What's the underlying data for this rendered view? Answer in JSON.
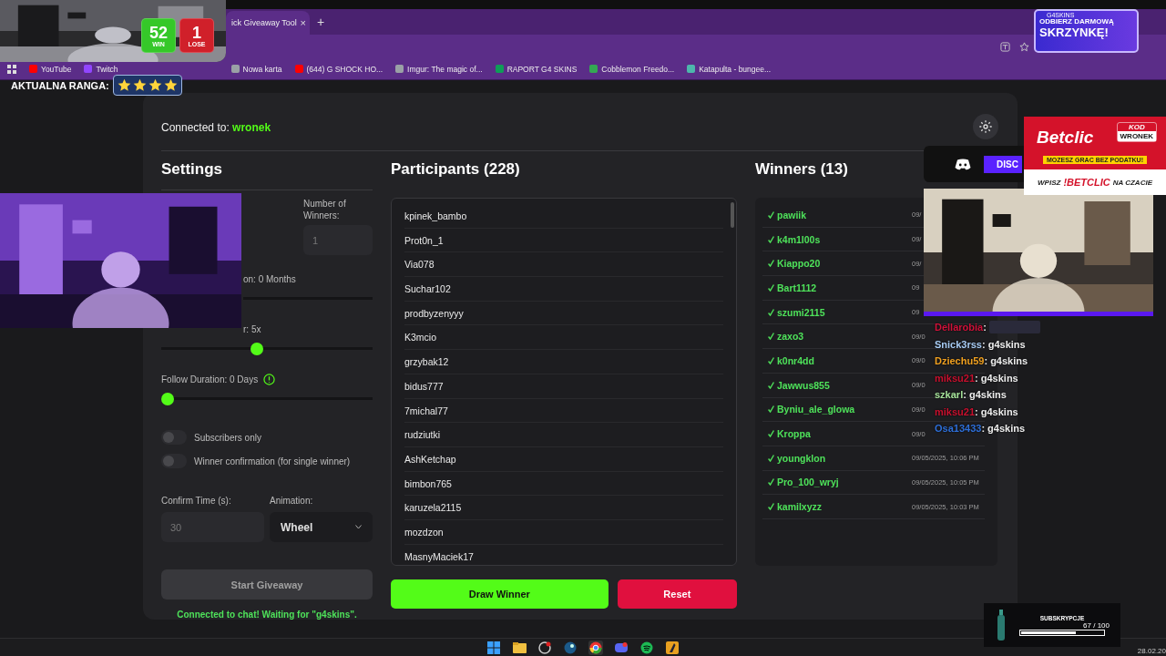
{
  "browser": {
    "tab": {
      "title": "ick Giveaway Tool",
      "close": "×"
    },
    "new_tab": "+",
    "bookmarks": [
      {
        "label": "YouTube",
        "color": "#ff0000"
      },
      {
        "label": "Twitch",
        "color": "#9146ff"
      },
      {
        "label": "Nowa karta",
        "color": "#9aa0a6"
      },
      {
        "label": "(644) G SHOCK HO...",
        "color": "#ff0000"
      },
      {
        "label": "Imgur: The magic of...",
        "color": "#9aa0a6"
      },
      {
        "label": "RAPORT G4 SKINS",
        "color": "#0f9d58"
      },
      {
        "label": "Cobblemon Freedo...",
        "color": "#34a853"
      },
      {
        "label": "Katapulta - bungee...",
        "color": "#4db6ac"
      }
    ]
  },
  "app": {
    "connected_label": "Connected to:",
    "channel": "wronek",
    "settings": {
      "title": "Settings",
      "winners_count": {
        "label": "Number of Winners:",
        "placeholder": "1"
      },
      "sliders": [
        {
          "label": "on: 0 Months",
          "covered": true
        },
        {
          "label": "r: 5x",
          "covered": true,
          "level": 0.45
        },
        {
          "label": "Follow Duration: 0 Days",
          "level": 0
        }
      ],
      "toggles": [
        {
          "label": "Subscribers only",
          "on": false
        },
        {
          "label": "Winner confirmation (for single winner)",
          "on": false
        }
      ],
      "confirm_time": {
        "label": "Confirm Time (s):",
        "placeholder": "30"
      },
      "animation": {
        "label": "Animation:",
        "value": "Wheel"
      },
      "start_button": {
        "label": "Start Giveaway",
        "disabled": true
      },
      "status": "Connected to chat! Waiting for \"g4skins\"."
    },
    "participants": {
      "title": "Participants (228)",
      "names": [
        "kpinek_bambo",
        "Prot0n_1",
        "Via078",
        "Suchar102",
        "prodbyzenyyy",
        "K3mcio",
        "grzybak12",
        "bidus777",
        "7michal77",
        "rudziutki",
        "AshKetchap",
        "bimbon765",
        "karuzela2115",
        "mozdzon",
        "MasnyMaciek17"
      ]
    },
    "winners": {
      "title": "Winners (13)",
      "rows": [
        {
          "name": "pawiik",
          "date": "09/"
        },
        {
          "name": "k4m1l00s",
          "date": "09/"
        },
        {
          "name": "Kiappo20",
          "date": "09/"
        },
        {
          "name": "Bart1112",
          "date": "09"
        },
        {
          "name": "szumi2115",
          "date": "09"
        },
        {
          "name": "zaxo3",
          "date": "09/0"
        },
        {
          "name": "k0nr4dd",
          "date": "09/0"
        },
        {
          "name": "Jawwus855",
          "date": "09/0"
        },
        {
          "name": "Byniu_ale_glowa",
          "date": "09/0"
        },
        {
          "name": "Kroppa",
          "date": "09/0"
        },
        {
          "name": "youngklon",
          "date": "09/05/2025, 10:06 PM"
        },
        {
          "name": "Pro_100_wryj",
          "date": "09/05/2025, 10:05 PM"
        },
        {
          "name": "kamilxyzz",
          "date": "09/05/2025, 10:03 PM"
        }
      ]
    },
    "draw_button": "Draw Winner",
    "reset_button": "Reset"
  },
  "overlays": {
    "score": {
      "wins": "52",
      "wins_label": "WIN",
      "losses": "1",
      "losses_label": "LOSE"
    },
    "rank": {
      "label": "AKTUALNA RANGA:",
      "stars": 4
    },
    "promo": {
      "brand": "G4SKINS",
      "line1": "ODBIERZ DARMOWĄ",
      "line2": "SKRZYNKĘ!"
    },
    "discord": {
      "label": "DISC"
    },
    "betclic": {
      "brand": "Betclic",
      "code_label": "KOD",
      "code": "WRONEK",
      "tagline": "MOZESZ GRAC BEZ PODATKU!",
      "cta_1": "WPISZ",
      "cta_2": "!BETCLIC",
      "cta_3": "NA CZACIE"
    },
    "chat": [
      {
        "name": "Dellarobia",
        "color": "#d0123a",
        "kind": "emote",
        "message": ":"
      },
      {
        "name": "Snick3rss",
        "color": "#a9cdf5",
        "kind": "text",
        "message": ": g4skins"
      },
      {
        "name": "Dziechu59",
        "color": "#f0a020",
        "kind": "text",
        "message": ": g4skins"
      },
      {
        "name": "miksu21",
        "color": "#c8102e",
        "kind": "text",
        "message": ": g4skins"
      },
      {
        "name": "szkarl",
        "color": "#a6e39a",
        "kind": "text",
        "message": ": g4skins"
      },
      {
        "name": "miksu21",
        "color": "#c8102e",
        "kind": "text",
        "message": ": g4skins"
      },
      {
        "name": "Osa13433",
        "color": "#2e6fd8",
        "kind": "text",
        "message": ": g4skins"
      }
    ],
    "sub_goal": {
      "label": "SUBSKRYPCJE",
      "count": "67 / 100",
      "level": 0.67
    }
  },
  "taskbar": {
    "date": "28.02.20"
  }
}
